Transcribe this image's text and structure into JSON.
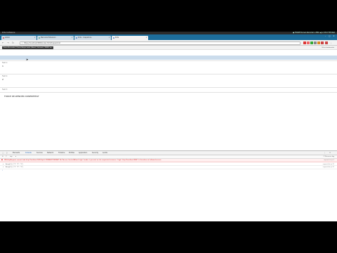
{
  "os_bar": {
    "left_text": "Krita  Conference",
    "right_text": "● FOSSEE Screen Recorder   ⊟  ENG  ◀)  ✉  05:27 PM  Wed"
  },
  "tabs": [
    {
      "label": "Admin"
    },
    {
      "label": "Mercurial Extension"
    },
    {
      "label": "Krita - Scapstrons"
    },
    {
      "label": "Krita"
    }
  ],
  "address_bar": {
    "url": "https://localhost:8080/index.html#repeat-list"
  },
  "bookmarks": {
    "chip_label": "Force Re-render | Cancel Async work | Abort | Go back | 'DRRV' on",
    "right_label": "Other bookmarks"
  },
  "page": {
    "field1_label": "Field 1:",
    "field1_value": "1",
    "field2_label": "Field 2:",
    "field2_value": "2",
    "field3_label": "Field 3:",
    "force_text": "FORCE RE-RENDER DONEREPEAT"
  },
  "devtools": {
    "tabs": [
      "Elements",
      "Console",
      "Sources",
      "Network",
      "Timeline",
      "Profiles",
      "Application",
      "Security",
      "Audits"
    ],
    "active_tab": "Console",
    "filter_context": "top",
    "preserve_log": "Preserve log",
    "error_message": "XMLHttpRequest cannot load http://localhost:9000/api/v1/DEFAULT/REPEAT. No 'Access-Control-Allow-Origin' header is present on the requested resource. Origin 'http://localhost:8080' is therefore not allowed access.",
    "error_source": "repeat-list.js:1",
    "log_rows": [
      {
        "text": "Array[3] : [\"1\", \"2\", \"3\"]",
        "source": "repeat-list.js:17"
      },
      {
        "text": "Array[3] : [\"1\", \"2\", \"3\"]",
        "source": "repeat-list.js:17"
      }
    ]
  }
}
